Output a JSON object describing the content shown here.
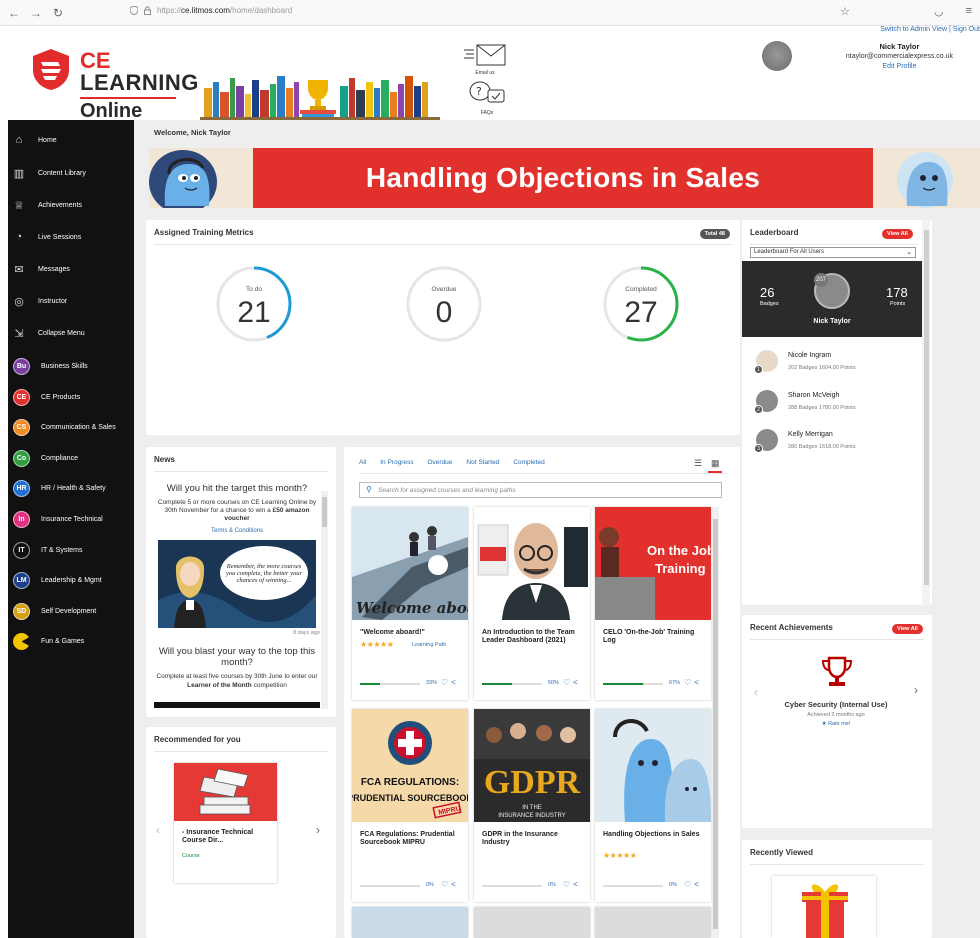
{
  "browser": {
    "back": "←",
    "forward": "→",
    "reload": "↻",
    "url_prefix": "https://",
    "url_domain": "ce.litmos.com",
    "url_path": "/home/dashboard"
  },
  "header": {
    "logo_ce": "CE",
    "logo_learning": "LEARNING",
    "logo_online": "Online",
    "email_label": "Email us",
    "faq_label": "FAQs",
    "switch_link": "Switch to Admin View",
    "sign_out": "Sign Out",
    "user_name": "Nick Taylor",
    "user_email": "ntaylor@commercialexpress.co.uk",
    "edit_profile": "Edit Profile"
  },
  "sidebar": {
    "nav": [
      {
        "label": "Home",
        "icon": "home-icon",
        "glyph": "⌂"
      },
      {
        "label": "Content Library",
        "icon": "library-icon",
        "glyph": "▥"
      },
      {
        "label": "Achievements",
        "icon": "trophy-icon",
        "glyph": "♕"
      },
      {
        "label": "Live Sessions",
        "icon": "live-session-icon",
        "glyph": "◔"
      },
      {
        "label": "Messages",
        "icon": "messages-icon",
        "glyph": "✉"
      },
      {
        "label": "Instructor",
        "icon": "instructor-icon",
        "glyph": "◎"
      },
      {
        "label": "Collapse Menu",
        "icon": "collapse-menu-icon",
        "glyph": "⇲"
      }
    ],
    "categories": [
      {
        "label": "Business Skills",
        "badge": "Bu",
        "color": "#7b3fa0"
      },
      {
        "label": "CE Products",
        "badge": "CE",
        "color": "#e2312c"
      },
      {
        "label": "Communication & Sales",
        "badge": "CS",
        "color": "#f08a24"
      },
      {
        "label": "Compliance",
        "badge": "Co",
        "color": "#2e9e3e"
      },
      {
        "label": "HR / Health & Safety",
        "badge": "HR",
        "color": "#1f6fd1"
      },
      {
        "label": "Insurance Technical",
        "badge": "In",
        "color": "#e0337f"
      },
      {
        "label": "IT & Systems",
        "badge": "IT",
        "color": "#111111"
      },
      {
        "label": "Leadership & Mgmt",
        "badge": "LM",
        "color": "#1d3f8a"
      },
      {
        "label": "Self Development",
        "badge": "SD",
        "color": "#d4a012"
      },
      {
        "label": "Fun & Games",
        "badge": "",
        "color": "#f5c400"
      }
    ]
  },
  "main": {
    "welcome": "Welcome, Nick Taylor",
    "banner_title": "Handling Objections in Sales"
  },
  "metrics": {
    "title": "Assigned Training Metrics",
    "total": "Total 48",
    "items": [
      {
        "label": "To do",
        "value": "21",
        "fraction": 0.44,
        "color": "#1a9bd7"
      },
      {
        "label": "Overdue",
        "value": "0",
        "fraction": 0,
        "color": "#e2312c"
      },
      {
        "label": "Completed",
        "value": "27",
        "fraction": 0.56,
        "color": "#2ab24a"
      }
    ]
  },
  "leaderboard": {
    "title": "Leaderboard",
    "view_all": "View All",
    "select_value": "Leaderboard For All Users",
    "me": {
      "badges": "26",
      "badges_label": "Badges",
      "points": "178",
      "points_label": "Points",
      "rank": "207",
      "name": "Nick Taylor"
    },
    "rows": [
      {
        "rank": "1",
        "name": "Nicole Ingram",
        "stats": "202 Badges   1604.00 Points"
      },
      {
        "rank": "2",
        "name": "Sharon McVeigh",
        "stats": "288 Badges   1780.00 Points"
      },
      {
        "rank": "3",
        "name": "Kelly Merrigan",
        "stats": "280 Badges   1618.00 Points"
      }
    ]
  },
  "news": {
    "title": "News",
    "h1": "Will you hit the target this month?",
    "p1": "Complete 5 or more courses on CE Learning Online by 30th November for a chance to win a",
    "p1_bold": "£50 amazon voucher",
    "terms": "Terms & Conditions",
    "bubble": "Remember, the more courses you complete, the better your chances of winning...",
    "ago": "8 days ago",
    "h2": "Will you blast your way to the top this month?",
    "p2": "Complete at least five courses by 30th June to enter our",
    "p2_bold": "Learner of the Month",
    "p2_end": "competition"
  },
  "courses": {
    "tabs": [
      "All",
      "In Progress",
      "Overdue",
      "Not Started",
      "Completed"
    ],
    "search_placeholder": "Search for assigned courses and learning paths",
    "items": [
      {
        "title": "\"Welcome aboard!\"",
        "stars": "★★★★★",
        "tag": "Learning Path",
        "progress": 0.33,
        "pct": "33%"
      },
      {
        "title": "An Introduction to the Team Leader Dashboard (2021)",
        "stars": "",
        "tag": "",
        "progress": 0.5,
        "pct": "50%"
      },
      {
        "title": "CELO 'On-the-Job' Training Log",
        "stars": "",
        "tag": "",
        "progress": 0.67,
        "pct": "67%"
      },
      {
        "title": "FCA Regulations: Prudential Sourcebook MIPRU",
        "stars": "",
        "tag": "",
        "progress": 0,
        "pct": "0%"
      },
      {
        "title": "GDPR in the Insurance Industry",
        "stars": "",
        "tag": "",
        "progress": 0,
        "pct": "0%"
      },
      {
        "title": "Handling Objections in Sales",
        "stars": "★★★★★",
        "tag": "",
        "progress": 0,
        "pct": "0%"
      }
    ],
    "thumb_text": {
      "welcome": "Welcome aboard!",
      "otj": "On the Job Training",
      "fca": "FCA REGULATIONS: PRUDENTIAL SOURCEBOOK",
      "fca_stamp": "MIPRU",
      "gdpr": "GDPR",
      "gdpr_sub": "IN THE INSURANCE INDUSTRY"
    }
  },
  "recommended": {
    "title": "Recommended for you",
    "item_title": "- Insurance Technical Course Dir...",
    "item_tag": "Course"
  },
  "achievements": {
    "title": "Recent Achievements",
    "view_all": "View All",
    "name": "Cyber Security (Internal Use)",
    "when": "Achieved 2 months ago",
    "rate": "★ Rate me!"
  },
  "recent": {
    "title": "Recently Viewed"
  },
  "colors": {
    "accent_red": "#e2312c",
    "link_blue": "#2b6cb0",
    "sidebar_bg": "#111111",
    "page_bg": "#eeeeee"
  }
}
